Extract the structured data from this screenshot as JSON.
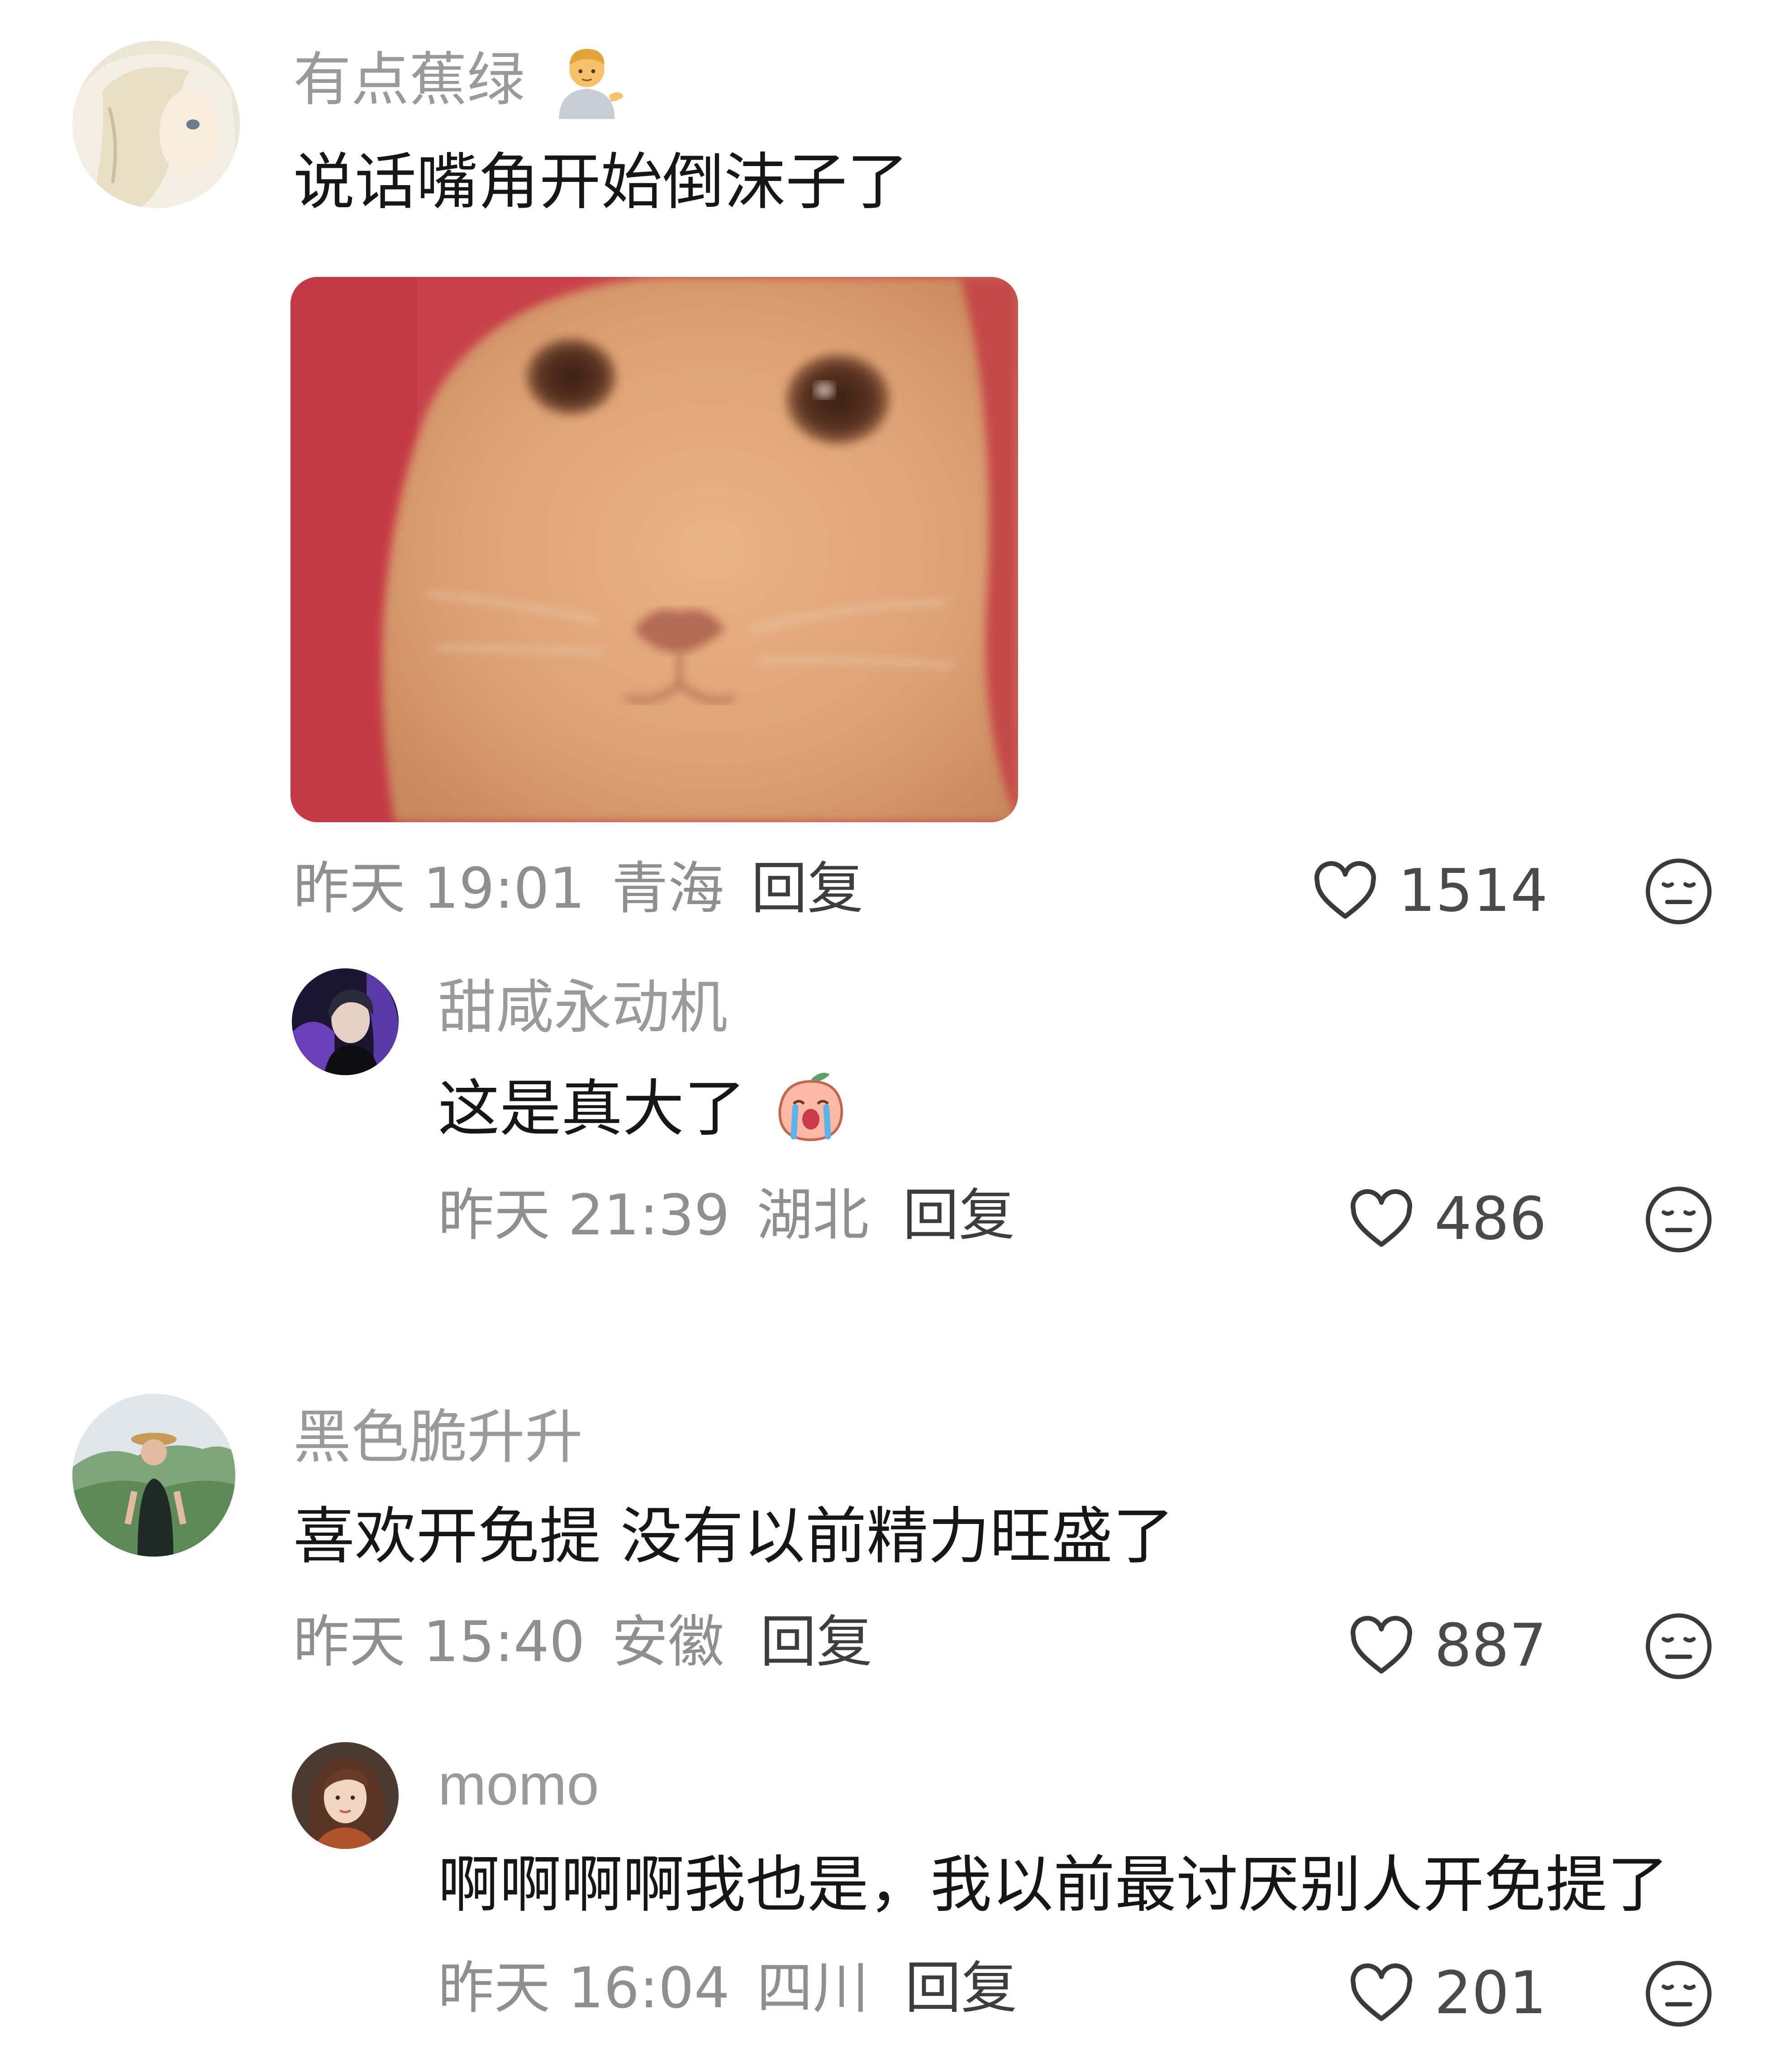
{
  "comments": [
    {
      "username": "有点蕉绿",
      "text": "说话嘴角开始倒沫子了",
      "time": "昨天 19:01",
      "location": "青海",
      "reply_label": "回复",
      "likes": "1514",
      "replies": [
        {
          "username": "甜咸永动机",
          "text": "这是真大了",
          "time": "昨天 21:39",
          "location": "湖北",
          "reply_label": "回复",
          "likes": "486"
        }
      ]
    },
    {
      "username": "黑色脆升升",
      "text": "喜欢开免提 没有以前精力旺盛了",
      "time": "昨天 15:40",
      "location": "安徽",
      "reply_label": "回复",
      "likes": "887",
      "replies": [
        {
          "username": "momo",
          "text": "啊啊啊啊我也是，我以前最讨厌别人开免提了",
          "time": "昨天 16:04",
          "location": "四川",
          "reply_label": "回复",
          "likes": "201"
        }
      ]
    }
  ],
  "icons": {
    "like": "heart-outline-icon",
    "reaction": "neutral-face-icon",
    "username_emoji": "person-tipping-hand-emoji",
    "reply_emoji": "crying-peach-emoji"
  },
  "colors": {
    "username": "#9a9a9a",
    "comment_text": "#161616",
    "meta": "#8f8f8f",
    "reply_button": "#3d3d3d",
    "icon_stroke": "#3a3a3a"
  }
}
